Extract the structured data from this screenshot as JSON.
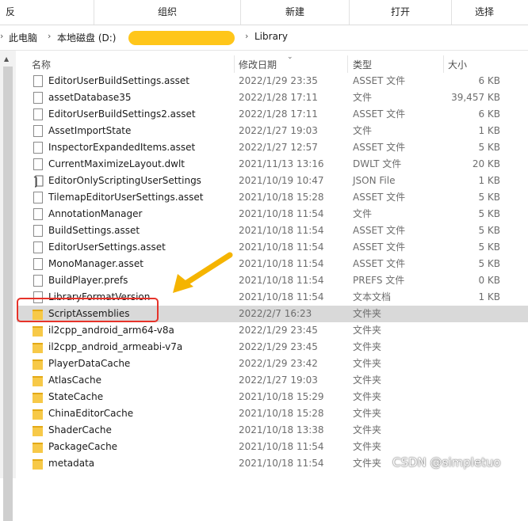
{
  "ribbon": {
    "left_partial": "反",
    "organize": "组织",
    "new": "新建",
    "open": "打开",
    "select": "选择"
  },
  "address": {
    "crumbs": [
      "此电脑",
      "本地磁盘 (D:)",
      "Library"
    ]
  },
  "columns": {
    "name": "名称",
    "date": "修改日期",
    "type": "类型",
    "size": "大小"
  },
  "files": [
    {
      "name": "EditorUserBuildSettings.asset",
      "date": "2022/1/29 23:35",
      "type": "ASSET 文件",
      "size": "6 KB",
      "icon": "file-icon"
    },
    {
      "name": "assetDatabase35",
      "date": "2022/1/28 17:11",
      "type": "文件",
      "size": "39,457 KB",
      "icon": "file-icon"
    },
    {
      "name": "EditorUserBuildSettings2.asset",
      "date": "2022/1/28 17:11",
      "type": "ASSET 文件",
      "size": "6 KB",
      "icon": "file-icon"
    },
    {
      "name": "AssetImportState",
      "date": "2022/1/27 19:03",
      "type": "文件",
      "size": "1 KB",
      "icon": "file-icon"
    },
    {
      "name": "InspectorExpandedItems.asset",
      "date": "2022/1/27 12:57",
      "type": "ASSET 文件",
      "size": "5 KB",
      "icon": "file-icon"
    },
    {
      "name": "CurrentMaximizeLayout.dwlt",
      "date": "2021/11/13 13:16",
      "type": "DWLT 文件",
      "size": "20 KB",
      "icon": "file-icon"
    },
    {
      "name": "EditorOnlyScriptingUserSettings",
      "date": "2021/10/19 10:47",
      "type": "JSON File",
      "size": "1 KB",
      "icon": "script-file-icon"
    },
    {
      "name": "TilemapEditorUserSettings.asset",
      "date": "2021/10/18 15:28",
      "type": "ASSET 文件",
      "size": "5 KB",
      "icon": "file-icon"
    },
    {
      "name": "AnnotationManager",
      "date": "2021/10/18 11:54",
      "type": "文件",
      "size": "5 KB",
      "icon": "file-icon"
    },
    {
      "name": "BuildSettings.asset",
      "date": "2021/10/18 11:54",
      "type": "ASSET 文件",
      "size": "5 KB",
      "icon": "file-icon"
    },
    {
      "name": "EditorUserSettings.asset",
      "date": "2021/10/18 11:54",
      "type": "ASSET 文件",
      "size": "5 KB",
      "icon": "file-icon"
    },
    {
      "name": "MonoManager.asset",
      "date": "2021/10/18 11:54",
      "type": "ASSET 文件",
      "size": "5 KB",
      "icon": "file-icon"
    },
    {
      "name": "BuildPlayer.prefs",
      "date": "2021/10/18 11:54",
      "type": "PREFS 文件",
      "size": "0 KB",
      "icon": "file-icon"
    },
    {
      "name": "LibraryFormatVersion",
      "date": "2021/10/18 11:54",
      "type": "文本文档",
      "size": "1 KB",
      "icon": "file-icon"
    },
    {
      "name": "ScriptAssemblies",
      "date": "2022/2/7 16:23",
      "type": "文件夹",
      "size": "",
      "icon": "folder-icon",
      "selected": true
    },
    {
      "name": "il2cpp_android_arm64-v8a",
      "date": "2022/1/29 23:45",
      "type": "文件夹",
      "size": "",
      "icon": "folder-icon"
    },
    {
      "name": "il2cpp_android_armeabi-v7a",
      "date": "2022/1/29 23:45",
      "type": "文件夹",
      "size": "",
      "icon": "folder-icon"
    },
    {
      "name": "PlayerDataCache",
      "date": "2022/1/29 23:42",
      "type": "文件夹",
      "size": "",
      "icon": "folder-icon"
    },
    {
      "name": "AtlasCache",
      "date": "2022/1/27 19:03",
      "type": "文件夹",
      "size": "",
      "icon": "folder-icon"
    },
    {
      "name": "StateCache",
      "date": "2021/10/18 15:29",
      "type": "文件夹",
      "size": "",
      "icon": "folder-icon"
    },
    {
      "name": "ChinaEditorCache",
      "date": "2021/10/18 15:28",
      "type": "文件夹",
      "size": "",
      "icon": "folder-icon"
    },
    {
      "name": "ShaderCache",
      "date": "2021/10/18 13:38",
      "type": "文件夹",
      "size": "",
      "icon": "folder-icon"
    },
    {
      "name": "PackageCache",
      "date": "2021/10/18 11:54",
      "type": "文件夹",
      "size": "",
      "icon": "folder-icon"
    },
    {
      "name": "metadata",
      "date": "2021/10/18 11:54",
      "type": "文件夹",
      "size": "",
      "icon": "folder-icon"
    }
  ],
  "watermark": "CSDN @simpletuo",
  "colors": {
    "selection": "#d9d9d9",
    "highlight_box": "#e6332a",
    "arrow": "#f5b400",
    "folder": "#f7c948"
  }
}
